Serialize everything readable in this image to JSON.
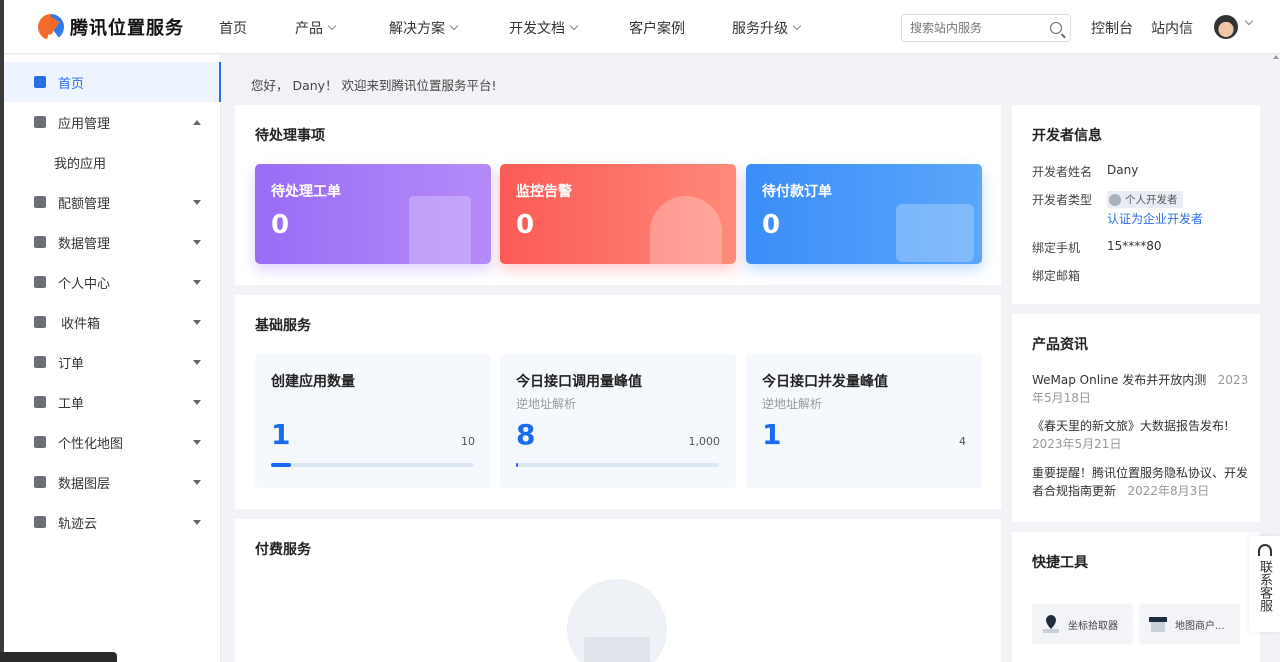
{
  "brand": {
    "name": "腾讯位置服务"
  },
  "nav": {
    "items": [
      {
        "label": "首页",
        "dropdown": false
      },
      {
        "label": "产品",
        "dropdown": true
      },
      {
        "label": "解决方案",
        "dropdown": true
      },
      {
        "label": "开发文档",
        "dropdown": true
      },
      {
        "label": "客户案例",
        "dropdown": false
      },
      {
        "label": "服务升级",
        "dropdown": true
      }
    ],
    "search_placeholder": "搜索站内服务",
    "console": "控制台",
    "inbox": "站内信"
  },
  "sidebar": {
    "items": [
      {
        "label": "首页",
        "icon": "home-list-icon",
        "active": true
      },
      {
        "label": "应用管理",
        "icon": "grid-icon",
        "expanded": true
      },
      {
        "label": "我的应用",
        "sub": true
      },
      {
        "label": "配额管理",
        "icon": "chart-icon"
      },
      {
        "label": "数据管理",
        "icon": "database-icon"
      },
      {
        "label": "个人中心",
        "icon": "user-icon"
      },
      {
        "label": "收件箱",
        "icon": "mail-icon"
      },
      {
        "label": "订单",
        "icon": "clipboard-icon"
      },
      {
        "label": "工单",
        "icon": "ticket-icon"
      },
      {
        "label": "个性化地图",
        "icon": "map-icon"
      },
      {
        "label": "数据图层",
        "icon": "layers-icon"
      },
      {
        "label": "轨迹云",
        "icon": "track-icon"
      }
    ]
  },
  "greeting": "您好， Dany！ 欢迎来到腾讯位置服务平台!",
  "pending": {
    "title": "待处理事项",
    "cards": [
      {
        "label": "待处理工单",
        "value": "0",
        "color_from": "#9a6cf6",
        "color_to": "#b58bf9"
      },
      {
        "label": "监控告警",
        "value": "0",
        "color_from": "#fb5a56",
        "color_to": "#ff8a7a"
      },
      {
        "label": "待付款订单",
        "value": "0",
        "color_from": "#3b8df8",
        "color_to": "#5aa6fb"
      }
    ]
  },
  "basic": {
    "title": "基础服务",
    "cards": [
      {
        "title": "创建应用数量",
        "subtitle": "",
        "value": "1",
        "max": "10",
        "progress": 0.1
      },
      {
        "title": "今日接口调用量峰值",
        "subtitle": "逆地址解析",
        "value": "8",
        "max": "1,000",
        "progress": 0.008
      },
      {
        "title": "今日接口并发量峰值",
        "subtitle": "逆地址解析",
        "value": "1",
        "max": "4",
        "progress": 0.0
      }
    ]
  },
  "paid": {
    "title": "付费服务"
  },
  "developer": {
    "title": "开发者信息",
    "name_label": "开发者姓名",
    "name": "Dany",
    "type_label": "开发者类型",
    "type_badge": "个人开发者",
    "type_link": "认证为企业开发者",
    "phone_label": "绑定手机",
    "phone": "15****80",
    "email_label": "绑定邮箱"
  },
  "news": {
    "title": "产品资讯",
    "items": [
      {
        "text": "WeMap Online 发布并开放内测",
        "date": "2023年5月18日"
      },
      {
        "text": "《春天里的新文旅》大数据报告发布!",
        "date": "2023年5月21日"
      },
      {
        "text": "重要提醒！腾讯位置服务隐私协议、开发者合规指南更新",
        "date": "2022年8月3日"
      }
    ]
  },
  "tools": {
    "title": "快捷工具",
    "items": [
      {
        "label": "坐标拾取器",
        "icon": "map-pin-icon"
      },
      {
        "label": "地图商户...",
        "icon": "store-icon"
      }
    ]
  },
  "contact": "联系客服"
}
